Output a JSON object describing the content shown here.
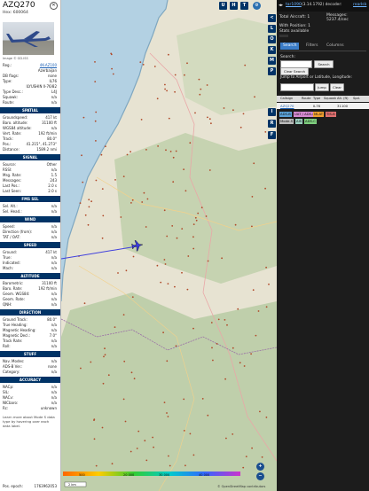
{
  "left_panel": {
    "callsign": "AZQ270",
    "hex_label": "Hex:",
    "hex": "600064",
    "photo_credit": "Image © GD.ISS",
    "info": [
      {
        "k": "Reg.:",
        "v": "4K-AZ100",
        "link": true
      },
      {
        "k": "",
        "v": "Azerbaijan"
      },
      {
        "k": "DB flags:",
        "v": "none"
      },
      {
        "k": "Type:",
        "v": "IL76"
      },
      {
        "k": "",
        "v": "ILYUSHIN Il-76/82"
      },
      {
        "k": "Type Desc.:",
        "v": "L4J"
      },
      {
        "k": "Squawk:",
        "v": "n/a"
      },
      {
        "k": "Route:",
        "v": "n/a"
      }
    ],
    "sections": {
      "spatial": "SPATIAL",
      "signal": "SIGNAL",
      "fms_sel": "FMS SEL",
      "wind": "WIND",
      "speed": "SPEED",
      "altitude": "ALTITUDE",
      "direction": "DIRECTION",
      "stuff": "STUFF",
      "accuracy": "ACCURACY"
    },
    "spatial": [
      {
        "k": "Groundspeed:",
        "v": "417 kt"
      },
      {
        "k": "Baro. altitude:",
        "v": "31100 ft"
      },
      {
        "k": "WGS84 altitude:",
        "v": "n/a"
      },
      {
        "k": "Vert. Rate:",
        "v": "192 ft/min"
      },
      {
        "k": "Track:",
        "v": "80.0°"
      },
      {
        "k": "Pos.:",
        "v": "41.215°, 41.273°"
      },
      {
        "k": "Distance:",
        "v": "1589.2 nmi"
      }
    ],
    "signal": [
      {
        "k": "Source:",
        "v": "Other"
      },
      {
        "k": "RSSI:",
        "v": "n/a"
      },
      {
        "k": "Msg. Rate:",
        "v": "1.5"
      },
      {
        "k": "Messages:",
        "v": "243"
      },
      {
        "k": "Last Pos.:",
        "v": "2.0 s"
      },
      {
        "k": "Last Seen:",
        "v": "2.0 s"
      }
    ],
    "fms": [
      {
        "k": "Sel. Alt.:",
        "v": "n/a"
      },
      {
        "k": "Sel. Head.:",
        "v": "n/a"
      }
    ],
    "wind": [
      {
        "k": "Speed:",
        "v": "n/a"
      },
      {
        "k": "Direction (from):",
        "v": "n/a"
      },
      {
        "k": "TAT / OAT:",
        "v": "n/a"
      }
    ],
    "speed": [
      {
        "k": "Ground:",
        "v": "417 kt"
      },
      {
        "k": "True:",
        "v": "n/a"
      },
      {
        "k": "Indicated:",
        "v": "n/a"
      },
      {
        "k": "Mach:",
        "v": "n/a"
      }
    ],
    "altitude": [
      {
        "k": "Barometric:",
        "v": "31100 ft"
      },
      {
        "k": "Baro. Rate:",
        "v": "192 ft/min"
      },
      {
        "k": "Geom. WGS84:",
        "v": "n/a"
      },
      {
        "k": "Geom. Rate:",
        "v": "n/a"
      },
      {
        "k": "QNH:",
        "v": "n/a"
      }
    ],
    "direction": [
      {
        "k": "Ground Track:",
        "v": "80.0°"
      },
      {
        "k": "True Heading:",
        "v": "n/a"
      },
      {
        "k": "Magnetic Heading:",
        "v": "n/a"
      },
      {
        "k": "Magnetic Decl.:",
        "v": "7.0°"
      },
      {
        "k": "Track Rate:",
        "v": "n/a"
      },
      {
        "k": "Roll:",
        "v": "n/a"
      }
    ],
    "stuff": [
      {
        "k": "Nav. Modes:",
        "v": "n/a"
      },
      {
        "k": "ADS-B Ver.:",
        "v": "none"
      },
      {
        "k": "Category:",
        "v": "n/a"
      }
    ],
    "accuracy": [
      {
        "k": "NACp:",
        "v": "n/a"
      },
      {
        "k": "SIL:",
        "v": "n/a"
      },
      {
        "k": "NACv:",
        "v": "n/a"
      },
      {
        "k": "NICbaro:",
        "v": "n/a"
      },
      {
        "k": "Rc:",
        "v": "unknown"
      }
    ],
    "learn_more": "Learn more about Mode S data type by hovering over each data label.",
    "pos_epoch_label": "Pos. epoch:",
    "pos_epoch": "1763962053"
  },
  "map": {
    "buttons_top": [
      "U",
      "H",
      "T"
    ],
    "buttons_side": [
      "<",
      "L",
      "O",
      "K",
      "M",
      "P",
      "I",
      "R",
      "F"
    ],
    "scale_label": "2 km",
    "attribution": "© OpenStreetMap contributors",
    "legend_labels": [
      "500",
      "20 000",
      "30 000",
      "40 000"
    ],
    "zoom_in": "+",
    "zoom_out": "−",
    "colors": {
      "sea": "#b3d1e3",
      "land": "#e7e3d2",
      "forest": "#b8cca3",
      "track": "#4040dd",
      "aircraft": "#3a3ae0"
    }
  },
  "right_panel": {
    "title_link": "tar1090",
    "version": "(3.14.1792) decoder:",
    "decoder": "readsb",
    "total_label": "Total Aircraft:",
    "total": "1",
    "messages_label": "Messages:",
    "messages": "5237.4/sec",
    "with_pos_label": "With Position:",
    "with_pos": "1",
    "stats": "Stats available",
    "tabs": [
      "Search",
      "Filters",
      "Columns"
    ],
    "search_label": "Search:",
    "search_button": "Search",
    "clear_search": "Clear Search",
    "jump_label": "Jump to Airport or Latitude, Longitude:",
    "jump_button": "Jump",
    "clear_button": "Clear",
    "columns": [
      "Callsign",
      "Route",
      "Type",
      "Squawk",
      "Alt. (ft)",
      "Spd."
    ],
    "rows": [
      {
        "callsign": "AZQ270",
        "route": "",
        "type": "IL76",
        "squawk": "",
        "alt": "31100",
        "spd": ""
      }
    ],
    "badges": [
      {
        "label": "ADS-B",
        "bg": "#5aa0d6"
      },
      {
        "label": "UAT / ADS-R",
        "bg": "#d68ad2"
      },
      {
        "label": "MLAT",
        "bg": "#f0a030"
      },
      {
        "label": "TIS-B",
        "bg": "#e07070"
      },
      {
        "label": "Mode-S",
        "bg": "#bbbbbb"
      },
      {
        "label": "AIS",
        "bg": "#9cd0c0"
      },
      {
        "label": "ADS-C",
        "bg": "#7fd07f"
      }
    ]
  }
}
